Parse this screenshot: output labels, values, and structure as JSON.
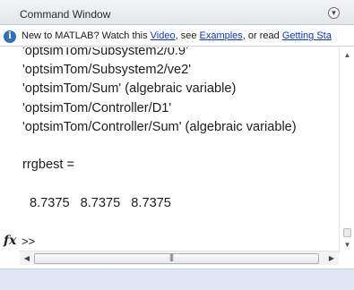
{
  "window": {
    "title": "Command Window",
    "menu_icon": "circle-chevron-down-icon"
  },
  "infobar": {
    "icon": "info-icon",
    "text_before": "New to MATLAB? Watch this ",
    "link_video": "Video",
    "text_mid1": ", see ",
    "link_examples": "Examples",
    "text_mid2": ", or read ",
    "link_getting_started": "Getting Sta"
  },
  "console": {
    "lines": [
      "'optsimTom/Subsystem2/0.9'",
      "'optsimTom/Subsystem2/ve2'",
      "'optsimTom/Sum' (algebraic variable)",
      "'optsimTom/Controller/D1'",
      "'optsimTom/Controller/Sum' (algebraic variable)"
    ],
    "result_name": "rrgbest =",
    "values": [
      "8.7375",
      "8.7375",
      "8.7375"
    ]
  },
  "prompt": {
    "fx_label": "fx",
    "symbol": ">>"
  },
  "hscroll": {
    "grip": "|||"
  }
}
